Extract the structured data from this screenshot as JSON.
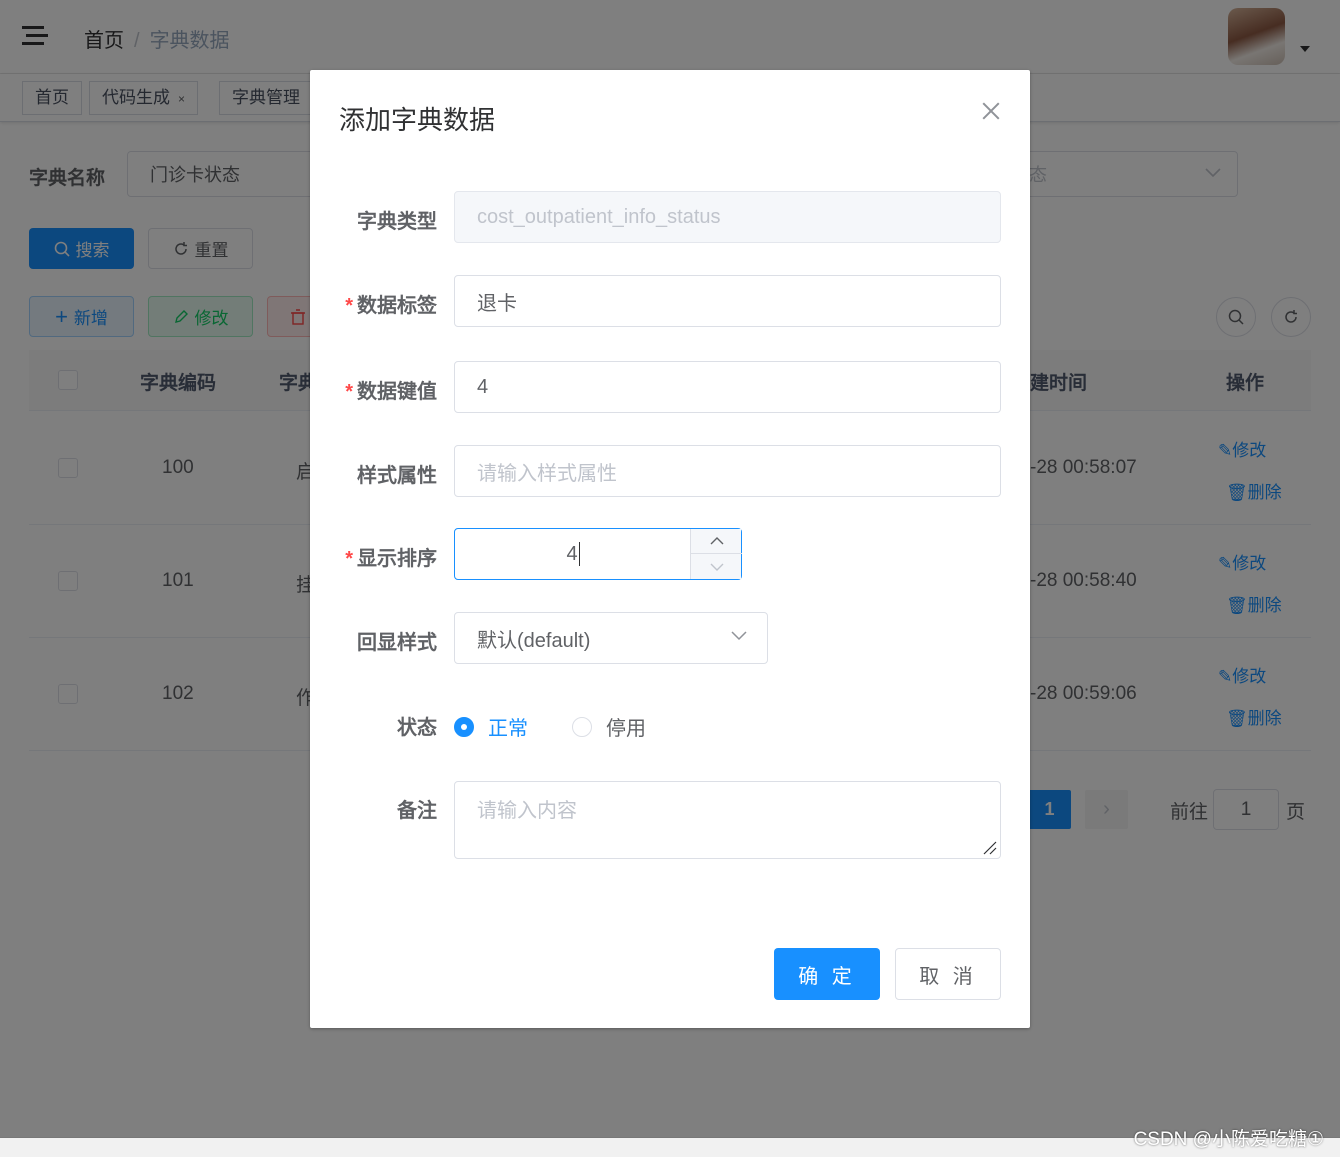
{
  "navbar": {
    "breadcrumb": {
      "home": "首页",
      "separator": "/",
      "current": "字典数据"
    }
  },
  "tags": [
    {
      "label": "首页"
    },
    {
      "label": "代码生成",
      "close": "×"
    },
    {
      "label": "字典管理"
    }
  ],
  "search": {
    "dict_name_label": "字典名称",
    "dict_name_value": "门诊卡状态",
    "status_placeholder_fragment": "态",
    "search_button": "搜索",
    "reset_button": "重置"
  },
  "toolbar": {
    "add_button": "新增",
    "edit_button": "修改"
  },
  "table": {
    "headers": {
      "code": "字典编码",
      "label": "字典",
      "create_time": "建时间",
      "actions": "操作"
    },
    "rows": [
      {
        "code": "100",
        "label": "启",
        "time": "-28 00:58:07",
        "edit": "修改",
        "delete": "删除"
      },
      {
        "code": "101",
        "label": "挂",
        "time": "-28 00:58:40",
        "edit": "修改",
        "delete": "删除"
      },
      {
        "code": "102",
        "label": "作",
        "time": "-28 00:59:06",
        "edit": "修改",
        "delete": "删除"
      }
    ]
  },
  "pagination": {
    "current_page": "1",
    "goto_label": "前往",
    "goto_value": "1",
    "page_suffix": "页"
  },
  "dialog": {
    "title": "添加字典数据",
    "fields": {
      "dict_type": {
        "label": "字典类型",
        "value": "cost_outpatient_info_status"
      },
      "dict_label": {
        "label": "数据标签",
        "value": "退卡"
      },
      "dict_value": {
        "label": "数据键值",
        "value": "4"
      },
      "css_class": {
        "label": "样式属性",
        "placeholder": "请输入样式属性"
      },
      "sort": {
        "label": "显示排序",
        "value": "4"
      },
      "list_class": {
        "label": "回显样式",
        "value": "默认(default)"
      },
      "status": {
        "label": "状态",
        "options": [
          "正常",
          "停用"
        ],
        "selected": "正常"
      },
      "remark": {
        "label": "备注",
        "placeholder": "请输入内容"
      }
    },
    "required_mark": "*",
    "confirm_button": "确 定",
    "cancel_button": "取 消"
  },
  "watermark": "CSDN @小陈爱吃糖①",
  "colors": {
    "primary": "#1890ff",
    "danger": "#ff4949",
    "success": "#13ce66"
  }
}
